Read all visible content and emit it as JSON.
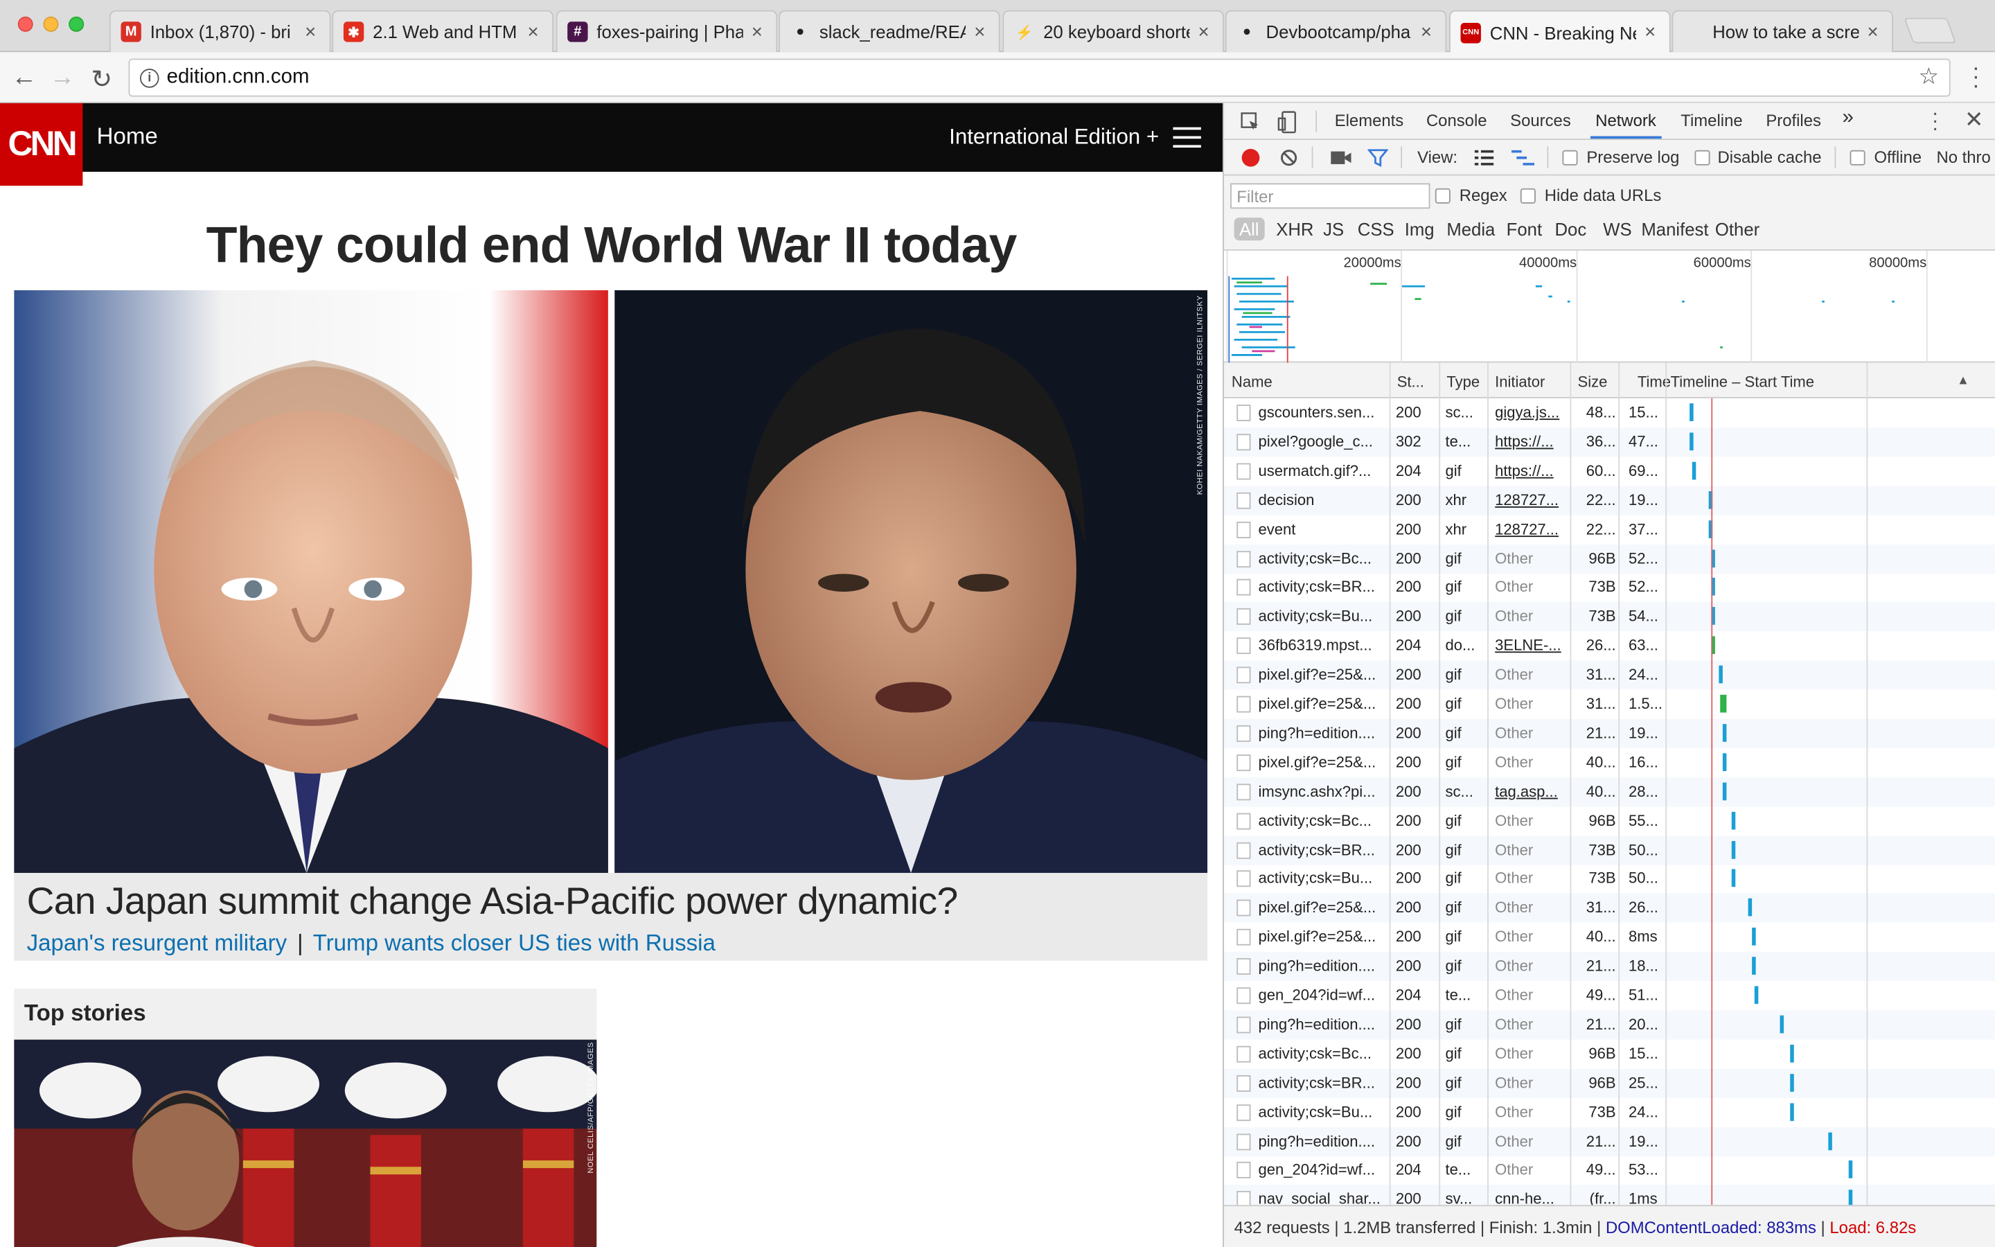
{
  "browser": {
    "tabs": [
      {
        "title": "Inbox (1,870) - bri",
        "icon": "gmail-icon",
        "active": false
      },
      {
        "title": "2.1 Web and HTM",
        "icon": "slides-icon",
        "active": false
      },
      {
        "title": "foxes-pairing | Pha",
        "icon": "slack-icon",
        "active": false
      },
      {
        "title": "slack_readme/REA",
        "icon": "github-icon",
        "active": false
      },
      {
        "title": "20 keyboard shorte",
        "icon": "lightning-icon",
        "active": false
      },
      {
        "title": "Devbootcamp/pha",
        "icon": "github-icon",
        "active": false
      },
      {
        "title": "CNN - Breaking Ne",
        "icon": "cnn-icon",
        "active": true
      },
      {
        "title": "How to take a scre",
        "icon": "apple-icon",
        "active": false
      }
    ],
    "url": "edition.cnn.com"
  },
  "cnn": {
    "logo": "CNN",
    "home": "Home",
    "edition": "International Edition +",
    "headline": "They could end World War II today",
    "photo_credit_left": "",
    "photo_credit_right": "KOHEI NAKAM/GETTY IMAGES / SERGEI ILNITSKY",
    "caption_title": "Can Japan summit change Asia-Pacific power dynamic?",
    "caption_link1": "Japan's resurgent military",
    "caption_sep": "|",
    "caption_link2": "Trump wants closer US ties with Russia",
    "top_stories": "Top stories",
    "ts_credit": "NOEL CELIS/AFP/GETTY IMAGES"
  },
  "devtools": {
    "tabs": [
      "Elements",
      "Console",
      "Sources",
      "Network",
      "Timeline",
      "Profiles"
    ],
    "more": "»",
    "view_label": "View:",
    "preserve_log": "Preserve log",
    "disable_cache": "Disable cache",
    "offline": "Offline",
    "throttle": "No thro",
    "filter_placeholder": "Filter",
    "regex": "Regex",
    "hide_data_urls": "Hide data URLs",
    "filter_types": [
      "All",
      "XHR",
      "JS",
      "CSS",
      "Img",
      "Media",
      "Font",
      "Doc",
      "WS",
      "Manifest",
      "Other"
    ],
    "overview_labels": [
      "20000ms",
      "40000ms",
      "60000ms",
      "80000ms"
    ],
    "columns": [
      "Name",
      "St...",
      "Type",
      "Initiator",
      "Size",
      "Time",
      "Timeline – Start Time"
    ],
    "rows": [
      {
        "name": "gscounters.sen...",
        "status": "200",
        "type": "sc...",
        "initiator": "gigya.js...",
        "size": "48...",
        "time": "15...",
        "start": 0.06
      },
      {
        "name": "pixel?google_c...",
        "status": "302",
        "type": "te...",
        "initiator": "https://...",
        "size": "36...",
        "time": "47...",
        "start": 0.06
      },
      {
        "name": "usermatch.gif?...",
        "status": "204",
        "type": "gif",
        "initiator": "https://...",
        "size": "60...",
        "time": "69...",
        "start": 0.065
      },
      {
        "name": "decision",
        "status": "200",
        "type": "xhr",
        "initiator": "128727...",
        "size": "22...",
        "time": "19...",
        "start": 0.12
      },
      {
        "name": "event",
        "status": "200",
        "type": "xhr",
        "initiator": "128727...",
        "size": "22...",
        "time": "37...",
        "start": 0.12
      },
      {
        "name": "activity;csk=Bc...",
        "status": "200",
        "type": "gif",
        "initiator": "Other",
        "size": "96B",
        "time": "52...",
        "start": 0.125
      },
      {
        "name": "activity;csk=BR...",
        "status": "200",
        "type": "gif",
        "initiator": "Other",
        "size": "73B",
        "time": "52...",
        "start": 0.125
      },
      {
        "name": "activity;csk=Bu...",
        "status": "200",
        "type": "gif",
        "initiator": "Other",
        "size": "73B",
        "time": "54...",
        "start": 0.125
      },
      {
        "name": "36fb6319.mpst...",
        "status": "204",
        "type": "do...",
        "initiator": "3ELNE-...",
        "size": "26...",
        "time": "63...",
        "start": 0.125
      },
      {
        "name": "pixel.gif?e=25&...",
        "status": "200",
        "type": "gif",
        "initiator": "Other",
        "size": "31...",
        "time": "24...",
        "start": 0.15
      },
      {
        "name": "pixel.gif?e=25&...",
        "status": "200",
        "type": "gif",
        "initiator": "Other",
        "size": "31...",
        "time": "1.5...",
        "start": 0.155
      },
      {
        "name": "ping?h=edition....",
        "status": "200",
        "type": "gif",
        "initiator": "Other",
        "size": "21...",
        "time": "19...",
        "start": 0.16
      },
      {
        "name": "pixel.gif?e=25&...",
        "status": "200",
        "type": "gif",
        "initiator": "Other",
        "size": "40...",
        "time": "16...",
        "start": 0.16
      },
      {
        "name": "imsync.ashx?pi...",
        "status": "200",
        "type": "sc...",
        "initiator": "tag.asp...",
        "size": "40...",
        "time": "28...",
        "start": 0.16
      },
      {
        "name": "activity;csk=Bc...",
        "status": "200",
        "type": "gif",
        "initiator": "Other",
        "size": "96B",
        "time": "55...",
        "start": 0.19
      },
      {
        "name": "activity;csk=BR...",
        "status": "200",
        "type": "gif",
        "initiator": "Other",
        "size": "73B",
        "time": "50...",
        "start": 0.19
      },
      {
        "name": "activity;csk=Bu...",
        "status": "200",
        "type": "gif",
        "initiator": "Other",
        "size": "73B",
        "time": "50...",
        "start": 0.19
      },
      {
        "name": "pixel.gif?e=25&...",
        "status": "200",
        "type": "gif",
        "initiator": "Other",
        "size": "31...",
        "time": "26...",
        "start": 0.24
      },
      {
        "name": "pixel.gif?e=25&...",
        "status": "200",
        "type": "gif",
        "initiator": "Other",
        "size": "40...",
        "time": "8ms",
        "start": 0.25
      },
      {
        "name": "ping?h=edition....",
        "status": "200",
        "type": "gif",
        "initiator": "Other",
        "size": "21...",
        "time": "18...",
        "start": 0.25
      },
      {
        "name": "gen_204?id=wf...",
        "status": "204",
        "type": "te...",
        "initiator": "Other",
        "size": "49...",
        "time": "51...",
        "start": 0.26
      },
      {
        "name": "ping?h=edition....",
        "status": "200",
        "type": "gif",
        "initiator": "Other",
        "size": "21...",
        "time": "20...",
        "start": 0.34
      },
      {
        "name": "activity;csk=Bc...",
        "status": "200",
        "type": "gif",
        "initiator": "Other",
        "size": "96B",
        "time": "15...",
        "start": 0.37
      },
      {
        "name": "activity;csk=BR...",
        "status": "200",
        "type": "gif",
        "initiator": "Other",
        "size": "96B",
        "time": "25...",
        "start": 0.37
      },
      {
        "name": "activity;csk=Bu...",
        "status": "200",
        "type": "gif",
        "initiator": "Other",
        "size": "73B",
        "time": "24...",
        "start": 0.37
      },
      {
        "name": "ping?h=edition....",
        "status": "200",
        "type": "gif",
        "initiator": "Other",
        "size": "21...",
        "time": "19...",
        "start": 0.49
      },
      {
        "name": "gen_204?id=wf...",
        "status": "204",
        "type": "te...",
        "initiator": "Other",
        "size": "49...",
        "time": "53...",
        "start": 0.55
      },
      {
        "name": "nav_social_shar...",
        "status": "200",
        "type": "sv...",
        "initiator": "cnn-he...",
        "size": "(fr...",
        "time": "1ms",
        "start": 0.55
      }
    ],
    "status": {
      "requests": "432 requests",
      "transferred": "1.2MB transferred",
      "finish": "Finish: 1.3min",
      "dcl": "DOMContentLoaded: 883ms",
      "load": "Load: 6.82s"
    },
    "colors": {
      "accent": "#3879d9",
      "bar": "#1a9fd6",
      "dcl": "#1a1aa6",
      "load": "#d00000"
    }
  }
}
